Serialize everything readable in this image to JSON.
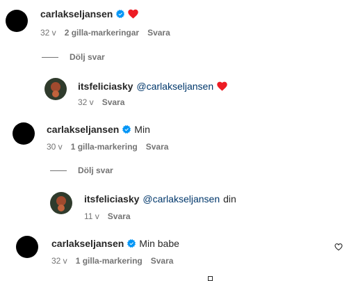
{
  "comments": [
    {
      "username": "carlakseljansen",
      "text": "",
      "heart": true,
      "time": "32 v",
      "likes": "2 gilla-markeringar",
      "reply": "Svara",
      "hide_replies": "Dölj svar",
      "replies": [
        {
          "username": "itsfeliciasky",
          "mention": "@carlakseljansen",
          "text": "",
          "heart": true,
          "time": "32 v",
          "reply": "Svara"
        }
      ]
    },
    {
      "username": "carlakseljansen",
      "text": "Min",
      "time": "30 v",
      "likes": "1 gilla-markering",
      "reply": "Svara",
      "hide_replies": "Dölj svar",
      "replies": [
        {
          "username": "itsfeliciasky",
          "mention": "@carlakseljansen",
          "text": "din",
          "time": "11 v",
          "reply": "Svara"
        }
      ]
    },
    {
      "username": "carlakseljansen",
      "text": "Min babe",
      "time": "32 v",
      "likes": "1 gilla-markering",
      "reply": "Svara"
    }
  ],
  "icons": {
    "verified": "verified-badge-icon",
    "heart_emoji": "red-heart-emoji",
    "like": "heart-outline-icon"
  },
  "colors": {
    "verified": "#0095f6",
    "heart": "#ed1c24",
    "mention": "#00376b",
    "meta": "#737373"
  }
}
